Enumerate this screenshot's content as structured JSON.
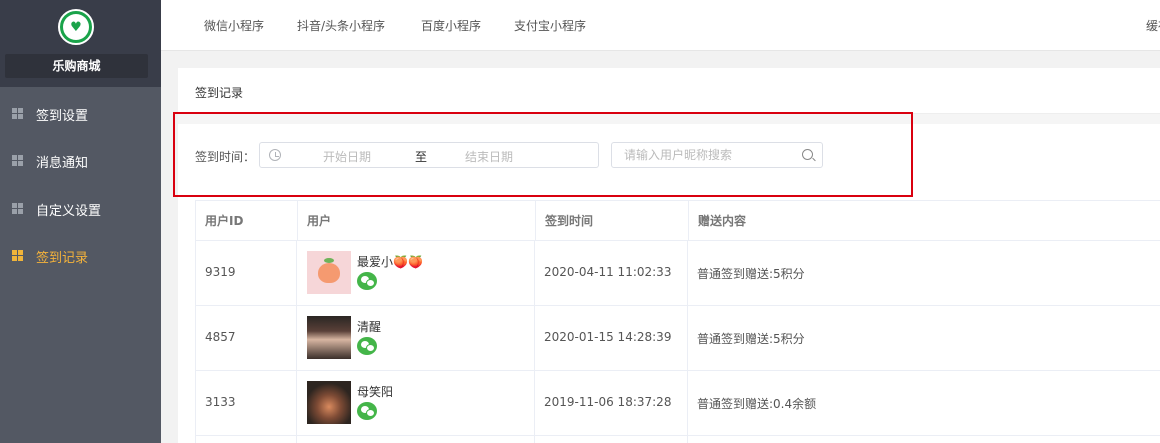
{
  "sidebar": {
    "shop_name": "乐购商城",
    "items": [
      {
        "label": "签到设置",
        "icon": "grid-icon",
        "active": false
      },
      {
        "label": "消息通知",
        "icon": "grid-icon",
        "active": false
      },
      {
        "label": "自定义设置",
        "icon": "grid-icon",
        "active": false
      },
      {
        "label": "签到记录",
        "icon": "grid-icon",
        "active": true
      }
    ],
    "accent_color": "#f5b33b"
  },
  "topnav": {
    "tabs": [
      "微信小程序",
      "抖音/头条小程序",
      "百度小程序",
      "支付宝小程序"
    ],
    "right_text": "缓存"
  },
  "page": {
    "title": "签到记录"
  },
  "filter": {
    "label": "签到时间：",
    "start_placeholder": "开始日期",
    "separator": "至",
    "end_placeholder": "结束日期",
    "search_placeholder": "请输入用户昵称搜索"
  },
  "table": {
    "columns": [
      "用户ID",
      "用户",
      "签到时间",
      "赠送内容"
    ],
    "rows": [
      {
        "id": "9319",
        "user": "最爱小🍑🍑",
        "time": "2020-04-11 11:02:33",
        "reward": "普通签到赠送:5积分",
        "avatar": "peach"
      },
      {
        "id": "4857",
        "user": "清醒",
        "time": "2020-01-15 14:28:39",
        "reward": "普通签到赠送:5积分",
        "avatar": "girl"
      },
      {
        "id": "3133",
        "user": "母笑阳",
        "time": "2019-11-06 18:37:28",
        "reward": "普通签到赠送:0.4余额",
        "avatar": "lamp"
      }
    ]
  }
}
